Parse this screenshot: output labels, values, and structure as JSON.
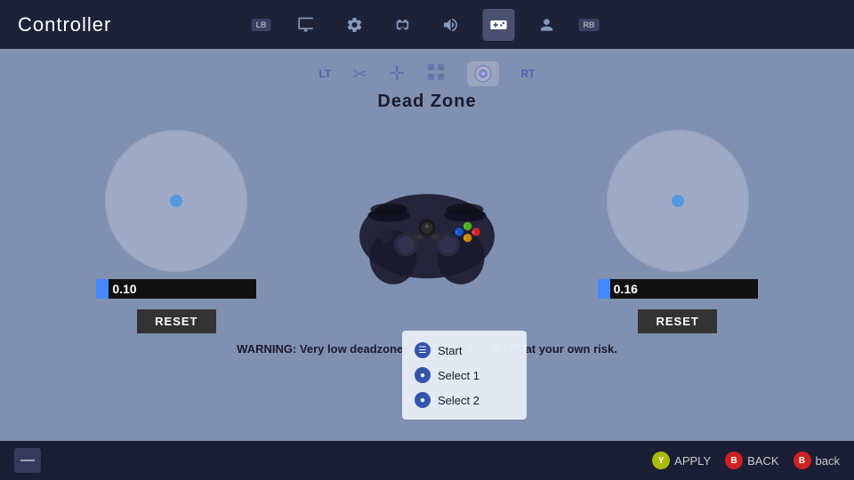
{
  "header": {
    "title": "Controller",
    "lb_label": "LB",
    "rb_label": "RB",
    "icons": [
      {
        "name": "monitor-icon",
        "symbol": "🖥",
        "active": false
      },
      {
        "name": "gear-icon",
        "symbol": "⚙",
        "active": false
      },
      {
        "name": "gamepad-config-icon",
        "symbol": "🎮",
        "active": false
      },
      {
        "name": "volume-icon",
        "symbol": "🔊",
        "active": false
      },
      {
        "name": "controller-icon",
        "symbol": "🎮",
        "active": true
      },
      {
        "name": "profile-icon",
        "symbol": "👤",
        "active": false
      }
    ]
  },
  "subtabs": [
    {
      "name": "LT",
      "label": "LT",
      "active": false
    },
    {
      "name": "scissors",
      "symbol": "✂",
      "active": false
    },
    {
      "name": "move",
      "symbol": "✛",
      "active": false
    },
    {
      "name": "grid",
      "symbol": "⊞",
      "active": false
    },
    {
      "name": "deadzone-circle",
      "symbol": "●",
      "active": true
    },
    {
      "name": "RT",
      "label": "RT",
      "active": false
    }
  ],
  "section": {
    "title": "Dead Zone"
  },
  "left_stick": {
    "value": "0.10",
    "reset_label": "RESET"
  },
  "right_stick": {
    "value": "0.16",
    "reset_label": "RESET"
  },
  "warning": {
    "text": "WARNING: Very low deadzones can cause drift. Use at your own risk."
  },
  "dropdown": {
    "items": [
      {
        "icon": "☰",
        "label": "Start"
      },
      {
        "icon": "●",
        "label": "Select 1"
      },
      {
        "icon": "●",
        "label": "Select 2"
      }
    ]
  },
  "bottom_bar": {
    "minus_label": "—",
    "apply_label": "APPLY",
    "back_label": "BACK",
    "back_label2": "back",
    "btn_y": "Y",
    "btn_b": "B"
  }
}
